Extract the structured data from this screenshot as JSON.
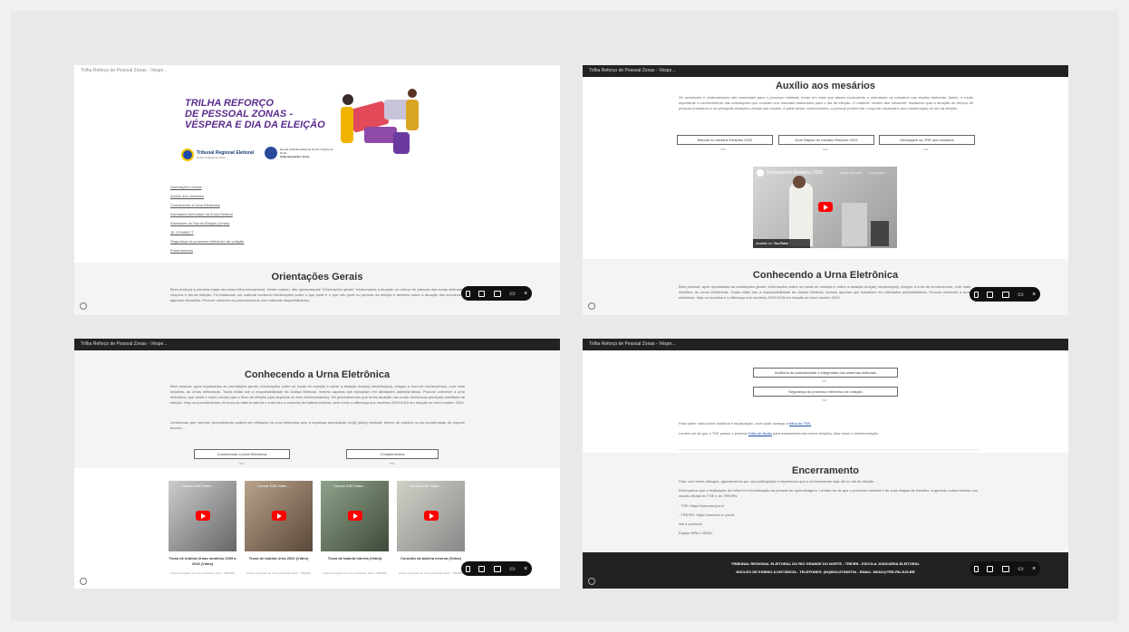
{
  "window_title": "Trilha Reforço de Pessoal Zonas - Véspe...",
  "colors": {
    "title_purple": "#5b2d8e",
    "bar_dark": "#222222",
    "toolbar": "#111111"
  },
  "panel1": {
    "hero_title": [
      "TRILHA REFORÇO",
      "DE PESSOAL ZONAS -",
      "VÉSPERA E DIA DA ELEIÇÃO"
    ],
    "logo_tre": "Tribunal Regional Eleitoral",
    "logo_tre_sub": "do Rio Grande do Norte",
    "logo_eje": "Escola Judiciária Eleitoral do Rio Grande do Norte",
    "logo_eje_sub": "Célia Guimarães Vieira",
    "links": [
      "Orientações Gerais",
      "Auxílio aos mesários",
      "Conhecendo a Urna Eletrônica",
      "Atividades Atribuídas da Zona Eleitoral",
      "Atividades do Dia da Eleição (Urnas)",
      "JE CONNECT",
      "Segurança do processo eletrônico de votação",
      "Encerramento"
    ],
    "section_title": "Orientações Gerais",
    "section_text": "Bem-vindo(a) à primeira etapa da nossa trilha educacional. Neste módulo, são apresentadas \"Orientações gerais\" relacionadas à atuação no reforço de pessoal das zonas eleitorais, na véspera e dia da eleição. Foi elaborado um material contendo informações sobre o que pode e o que não pode no período da eleição e também sobre a atuação dos servidores em algumas situações. Procure observar os procedimentos nos materiais disponibilizados."
  },
  "panel2": {
    "section_title": "Auxílio aos mesários",
    "section_text": "Os servidores e colaboradores são essenciais para o processo eleitoral, tendo em vista que atuam conduzindo e orientando os mesários nas seções eleitorais. Assim, é muito importante o conhecimento das orientações que constam nos manuais elaborados para o dia da eleição. O material \"Auxílio aos mesários\" esclarece qual a atuação do reforço de pessoal (mesários) e as principais situações vividas nas seções. A partir desse conhecimento, a pessoal poderá dar o suporte necessário aos mesários(as) no dia da eleição.",
    "buttons": [
      "Manual do mesário Eleições 2022",
      "Guia Rápido do mesário Eleições 2022",
      "Mensagem do TRE aos mesários"
    ],
    "pdf_label": "PDF",
    "video_title": "Treinamento Mesários 2022",
    "video_watch_later": "Assistir mais tarde",
    "video_share": "Compartilhar",
    "video_watch_on": "Assistir no",
    "video_platform": "YouTube",
    "next_title": "Conhecendo a Urna Eletrônica",
    "next_text": "Bem pessoal, após repassadas as orientações gerais, informações sobre os locais de votação e sobre a atuação dos(as) mesários(as), chegou a hora de conhecermos, com mais detalhes, as urnas eletrônicas. Todas estão sob a responsabilidade da Justiça Eleitoral, mesmo aquelas que trabalham em atividades administrativas. Procure conhecer a urna eletrônica. Veja os modelos e a diferença dos modelos 2009-2015 em relação ao novo modelo 2020."
  },
  "panel3": {
    "section_title": "Conhecendo a Urna Eletrônica",
    "section_text": "Bem pessoal, após repassadas as orientações gerais, informações sobre os locais de votação e sobre a atuação dos(as) mesários(as), chegou a hora de conhecermos, com mais detalhes, as urnas eletrônicas. Todas estão sob a responsabilidade da Justiça Eleitoral, mesmo aquelas que trabalham em atividades administrativas. Procure conhecer a urna eletrônica, que ainda é muito crucial para o fluxo de eleição (que depende do bom funcionamento). Há procedimentos que tenho atuação nas urnas eletrônicas pelos(as) auxiliares de eleição. Veja os procedimentos de troca da bateria interna e externa e a conexão da bateria externa, bem como a diferença dos modelos 2009-2015 em relação ao novo modelo 2020.",
    "section_text2": "Lembrando que nenhum procedimento poderá ser efetuado na urna eletrônica sem a expressa autorização do(a) juiz(a) eleitoral, diretor de cartório ou da coordenação de suporte técnico.",
    "buttons": [
      "Conhecendo a Urna Eletrônica",
      "Complementos"
    ],
    "pdf_label": "PDF",
    "video_header": "Cursos EAD Sabe...",
    "videos": [
      {
        "caption": "Troca de bobina Urnas modelos 2009 a 2015 (Vídeo)",
        "sub": "(Vídeo carregado do curso publicado 2022 - TRE/RN)"
      },
      {
        "caption": "Troca de bobina Urna 2020 (Vídeo)",
        "sub": "(Vídeo carregado do curso publicado 2022 - TRE/RN)"
      },
      {
        "caption": "Troca de bateria interna (Vídeo)",
        "sub": "(Vídeo carregado do curso publicado 2022 - TRE/RN)"
      },
      {
        "caption": "Conexão da bateria externa (Vídeo)",
        "sub": "(Vídeo carregado do curso publicado 2022 - TRE/RN)"
      }
    ]
  },
  "panel4": {
    "buttons": [
      "Auditoria da autenticidade e integridade dos sistemas eleitorais",
      "Segurança do processo eletrônico de votação"
    ],
    "pdf_label": "PDF",
    "text1": "Para saber mais sobre auditoria e fiscalização, você pode acessar a",
    "text1_link": "trilha do TSE.",
    "text2": "Lembre-se de que o TSE possui o podcast",
    "text2_link": "Falta de Boato",
    "text2_end": "para esclarecimentos sobre eleições, fake news e desinformação.",
    "section_title": "Encerramento",
    "closing_lines": [
      "Pois, com estes diálogos, agradecemos por sua participação e esperamos que o conhecimento seja útil no dia da eleição.",
      "Reforçamos que a finalização da trilha foi a formalização da jornada de aprendizagem. Lembre-se de que o processo eleitoral e de suas etapas de trabalho, sugerindo outras leituras nos canais oficiais do TSE e do TRE/RN.",
      "- TSE: https://www.tse.jus.br",
      "- TRE/RN: https://www.tre-rn.jus.br",
      "Até a próxima!",
      "Equipe NPA e NEAD."
    ],
    "footer_line1": "TRIBUNAL REGIONAL ELEITORAL DO RIO GRANDE DO NORTE - TRE/RN - ESCOLA JUDICIÁRIA ELEITORAL",
    "footer_line2": "NÚCLEO DE ENSINO A DISTÂNCIA - TELEFONES: (84)3654-5793/5794 - EMAIL: NEAD@TRE-RN.JUS.BR"
  },
  "toolbar_icons": [
    "phone-view-icon",
    "tablet-view-icon",
    "desktop-view-icon",
    "comment-icon",
    "close-icon"
  ]
}
